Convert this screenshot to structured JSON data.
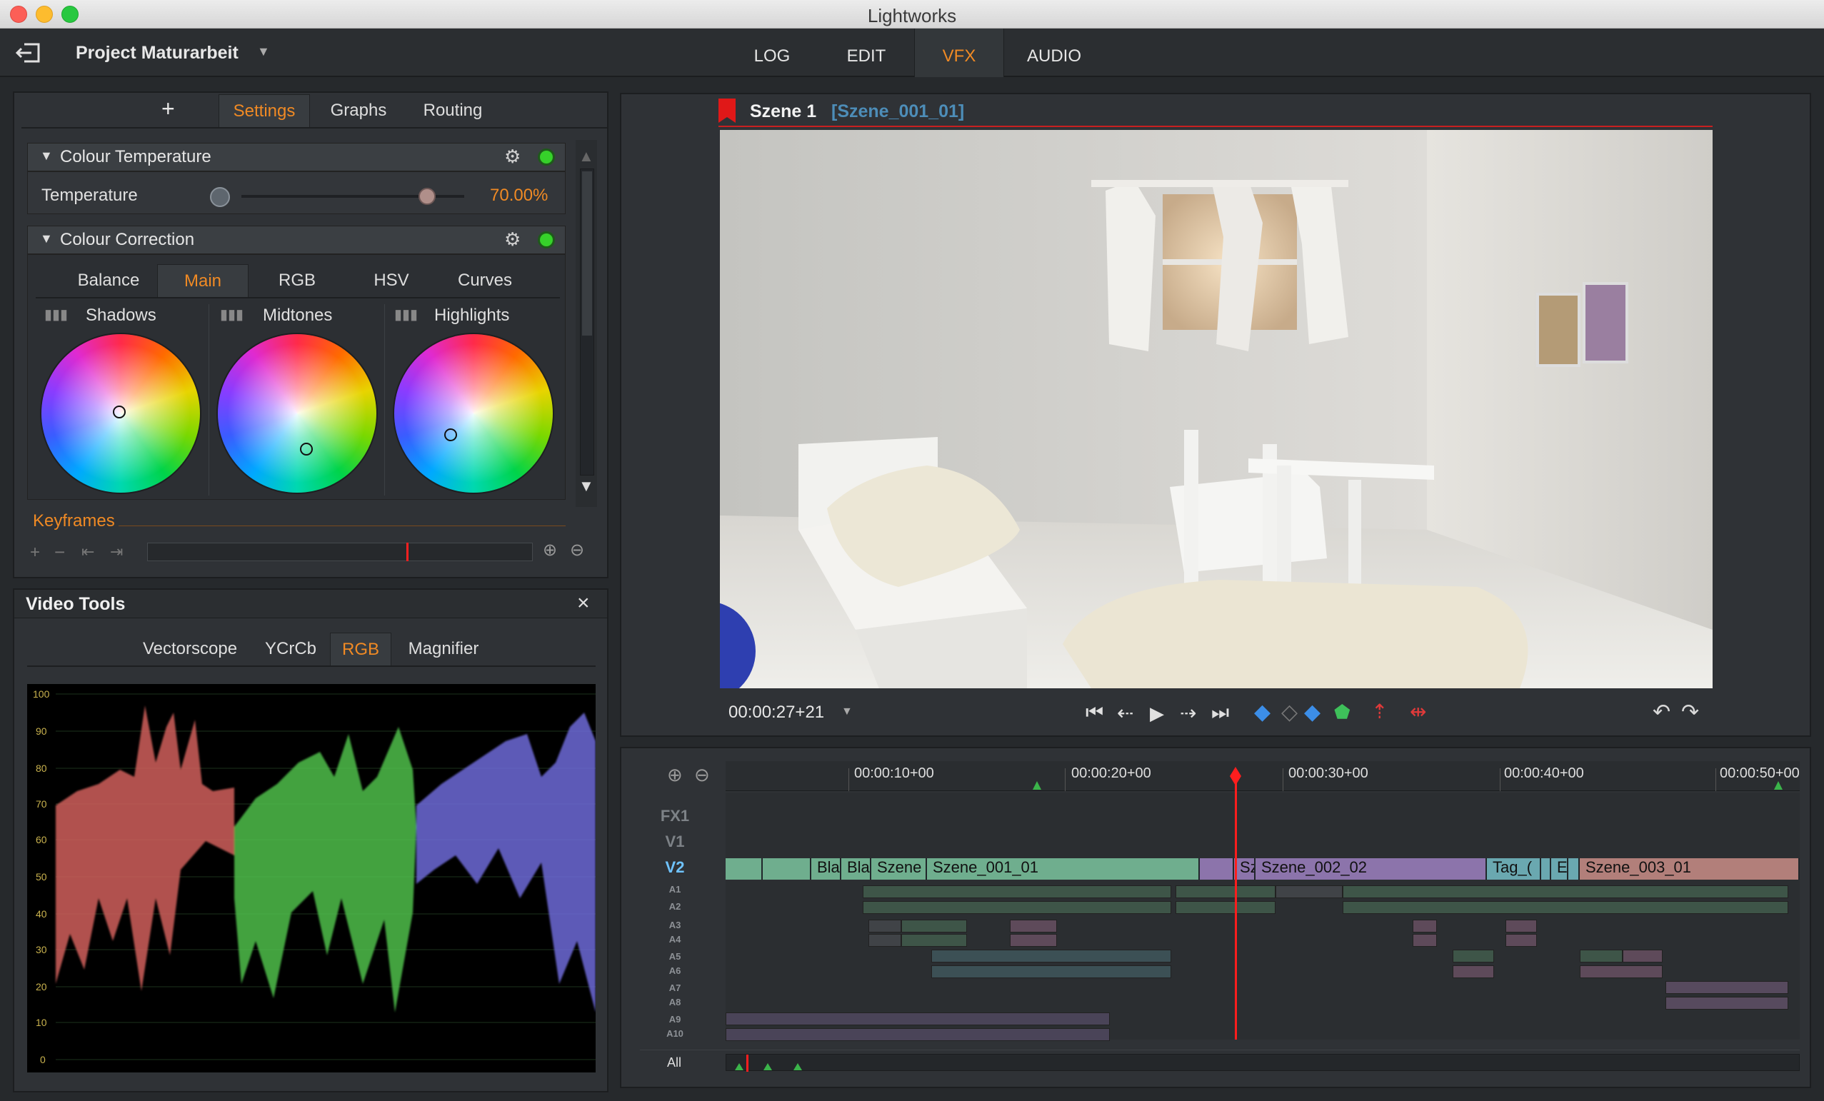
{
  "window": {
    "title": "Lightworks"
  },
  "header": {
    "project": "Project Maturarbeit",
    "tabs": [
      "LOG",
      "EDIT",
      "VFX",
      "AUDIO"
    ],
    "active_tab": "VFX"
  },
  "effects_panel": {
    "add_label": "+",
    "tabs": [
      "Settings",
      "Graphs",
      "Routing"
    ],
    "active_tab": "Settings",
    "colour_temperature": {
      "title": "Colour Temperature",
      "param_label": "Temperature",
      "value": "70.00%",
      "slider_fraction": 0.81
    },
    "colour_correction": {
      "title": "Colour Correction",
      "tabs": [
        "Balance",
        "Main",
        "RGB",
        "HSV",
        "Curves"
      ],
      "active_tab": "Main",
      "wheels": [
        {
          "label": "Shadows"
        },
        {
          "label": "Midtones"
        },
        {
          "label": "Highlights"
        }
      ]
    },
    "keyframes": {
      "label": "Keyframes"
    }
  },
  "video_tools": {
    "title": "Video Tools",
    "close": "×",
    "tabs": [
      "Vectorscope",
      "YCrCb",
      "RGB",
      "Magnifier"
    ],
    "active_tab": "RGB",
    "scale": [
      "100",
      "90",
      "80",
      "70",
      "60",
      "50",
      "40",
      "30",
      "20",
      "10",
      "0"
    ]
  },
  "viewer": {
    "scene": "Szene 1",
    "clip": "[Szene_001_01]",
    "timecode": "00:00:27+21"
  },
  "timeline": {
    "ruler": [
      "00:00:10+00",
      "00:00:20+00",
      "00:00:30+00",
      "00:00:40+00",
      "00:00:50+00"
    ],
    "tracks": [
      "FX1",
      "V1",
      "V2",
      "A1",
      "A2",
      "A3",
      "A4",
      "A5",
      "A6",
      "A7",
      "A8",
      "A9",
      "A10"
    ],
    "all_label": "All",
    "clips": [
      "Bla",
      "Bla",
      "Szene",
      "Szene_001_01",
      "Sz",
      "Szene_002_02",
      "Tag_(",
      "E",
      "Szene_003_01"
    ]
  },
  "colors": {
    "accent": "#f08a24",
    "active_track": "#6fc3ff",
    "playhead": "#ff1e1e",
    "clip_green": "#6fae8e",
    "clip_purple": "#8c74ab",
    "clip_teal": "#6aa8b0",
    "clip_rose": "#b27f7a"
  }
}
